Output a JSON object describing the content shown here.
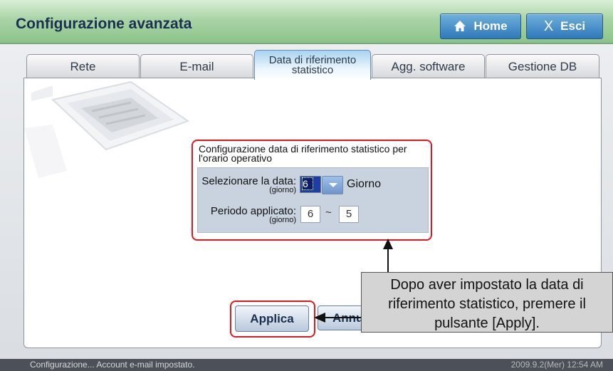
{
  "window": {
    "title": "Configurazione avanzata"
  },
  "header": {
    "home_label": "Home",
    "exit_label": "Esci"
  },
  "tabs": [
    {
      "label": "Rete"
    },
    {
      "label": "E-mail"
    },
    {
      "label_line1": "Data di riferimento",
      "label_line2": "statistico",
      "active": true
    },
    {
      "label": "Agg. software"
    },
    {
      "label": "Gestione DB"
    }
  ],
  "settings": {
    "group_title": "Configurazione data di riferimento statistico per l'orario operativo",
    "select_date_label": "Selezionare la data:",
    "select_date_sub": "(giorno)",
    "select_date_value": "6",
    "select_date_unit": "Giorno",
    "period_label": "Periodo applicato:",
    "period_sub": "(giorno)",
    "period_from": "6",
    "period_separator": "~",
    "period_to": "5"
  },
  "buttons": {
    "apply_label": "Applica",
    "cancel_label": "Annu"
  },
  "callout": {
    "text": "Dopo aver impostato la data di riferimento statistico, premere il pulsante [Apply]."
  },
  "status": {
    "left_text": "Configurazione... Account e-mail impostato.",
    "right_text": "2009.9.2(Mer)  12:54 AM"
  },
  "colors": {
    "highlight": "#e0191f",
    "title_bar": "#a9d4a6",
    "header_button": "#2f78b9"
  }
}
